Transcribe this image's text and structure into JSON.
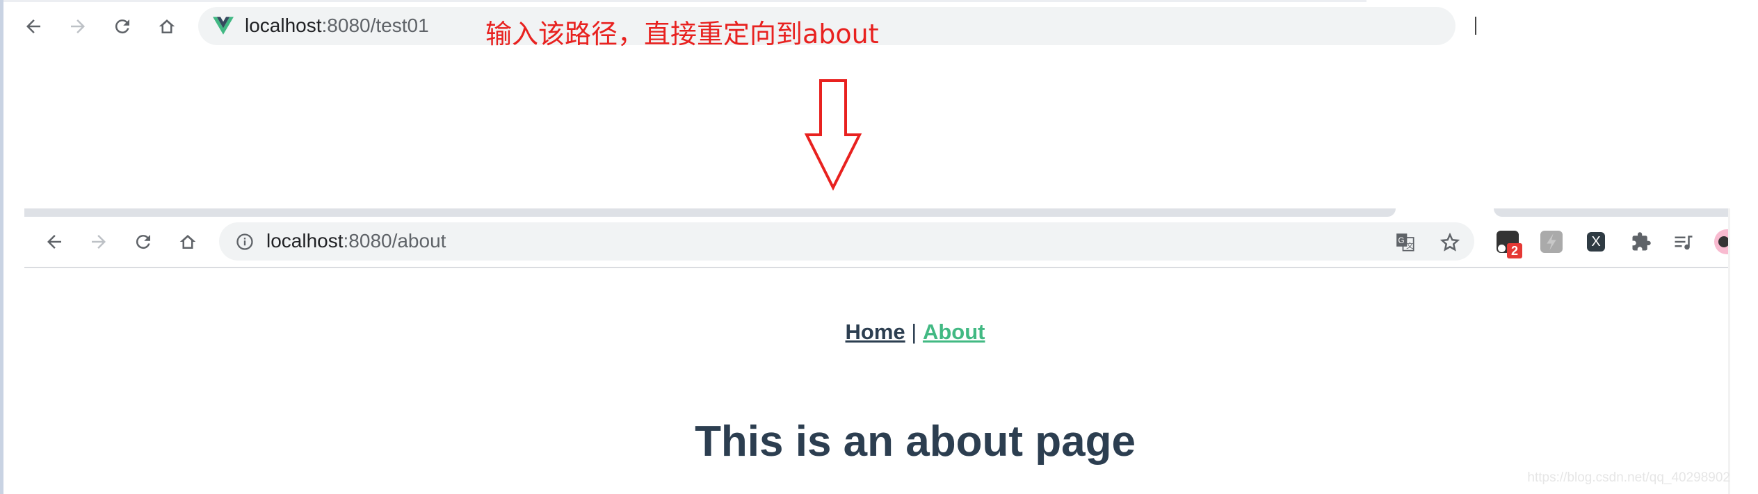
{
  "browser_top": {
    "url_host": "localhost",
    "url_rest": ":8080/test01",
    "favicon": "vue-logo-icon"
  },
  "annotation": {
    "text": "输入该路径，直接重定向到about",
    "color": "#e8211f",
    "arrow": "down-arrow-icon"
  },
  "browser_bottom": {
    "url_host": "localhost",
    "url_rest": ":8080/about",
    "extension_badge": "2"
  },
  "page": {
    "nav_home": "Home",
    "nav_sep": " | ",
    "nav_about": "About",
    "heading": "This is an about page",
    "text_color": "#2c3e50",
    "accent": "#42b983"
  },
  "watermark": "https://blog.csdn.net/qq_40298902"
}
